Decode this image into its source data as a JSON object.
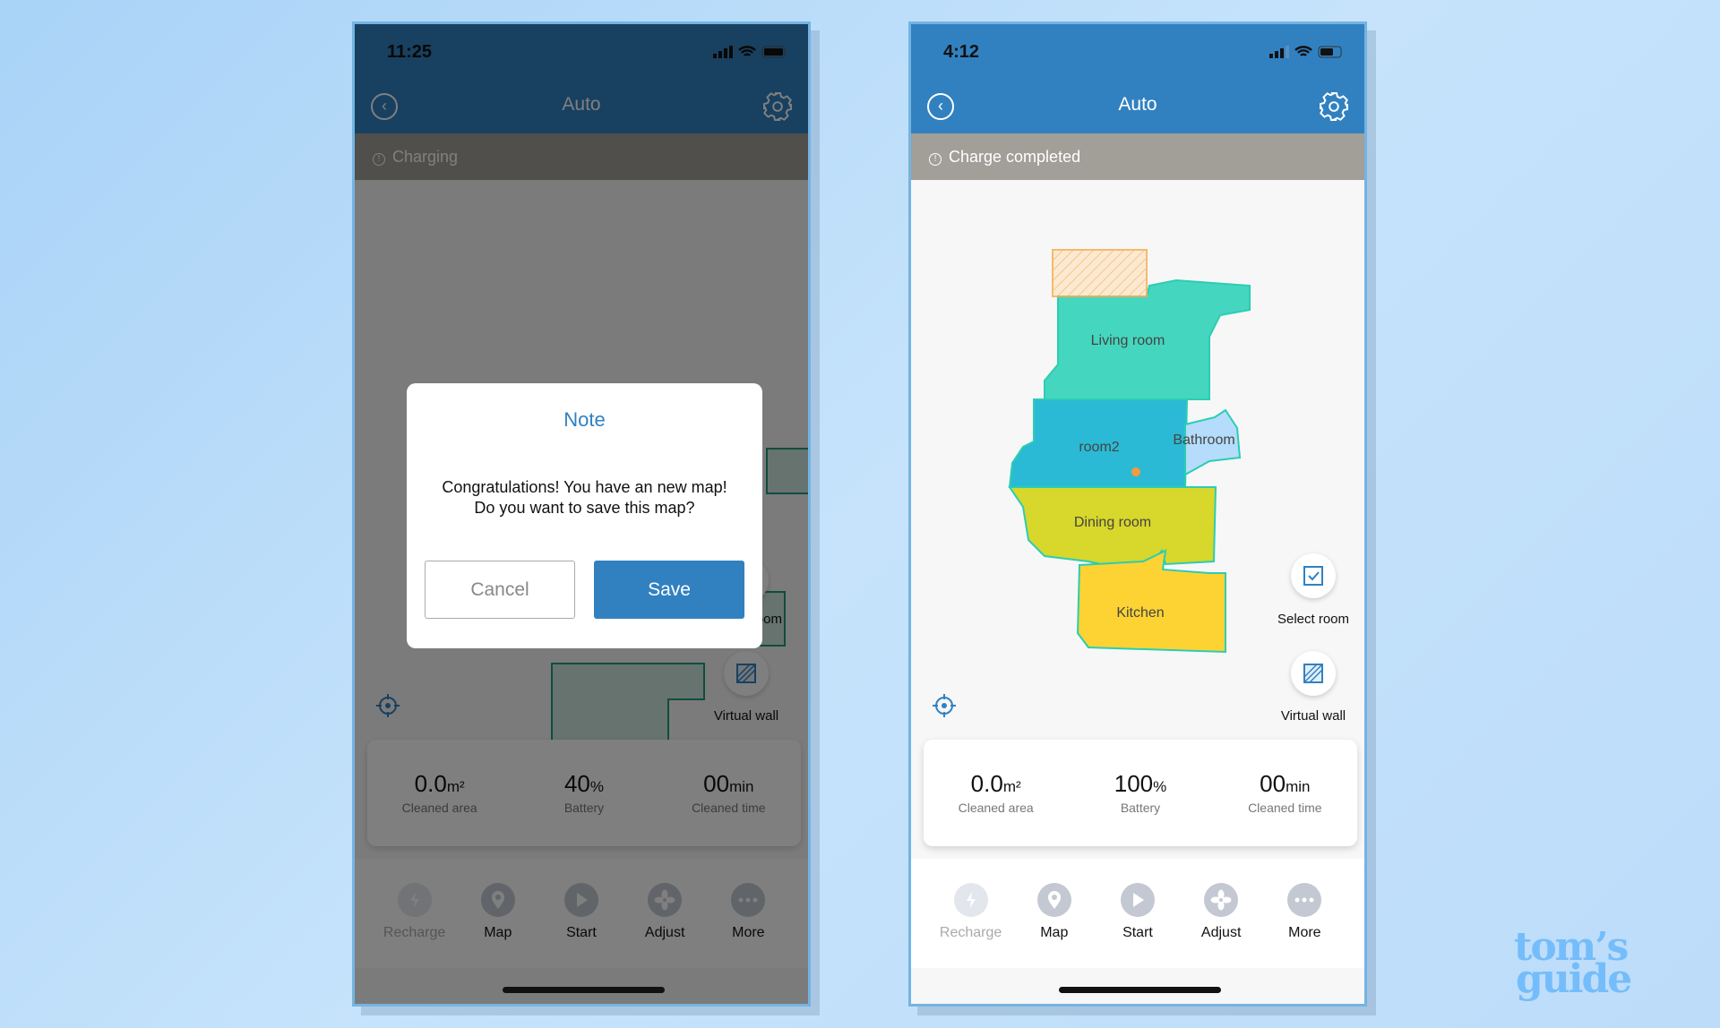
{
  "phones": [
    {
      "time": "11:25",
      "title": "Auto",
      "status": "Charging",
      "stats": [
        {
          "value": "0.0",
          "unit": "m²",
          "label": "Cleaned area"
        },
        {
          "value": "40",
          "unit": "%",
          "label": "Battery"
        },
        {
          "value": "00",
          "unit": "min",
          "label": "Cleaned time"
        }
      ],
      "select_room": "Select room",
      "virtual_wall": "Virtual wall",
      "nav": [
        "Recharge",
        "Map",
        "Start",
        "Adjust",
        "More"
      ],
      "dialog": {
        "title": "Note",
        "line1": "Congratulations! You have an new map!",
        "line2": "Do you want to save this map?",
        "cancel": "Cancel",
        "save": "Save"
      }
    },
    {
      "time": "4:12",
      "title": "Auto",
      "status": "Charge completed",
      "stats": [
        {
          "value": "0.0",
          "unit": "m²",
          "label": "Cleaned area"
        },
        {
          "value": "100",
          "unit": "%",
          "label": "Battery"
        },
        {
          "value": "00",
          "unit": "min",
          "label": "Cleaned time"
        }
      ],
      "select_room": "Select room",
      "virtual_wall": "Virtual wall",
      "nav": [
        "Recharge",
        "Map",
        "Start",
        "Adjust",
        "More"
      ],
      "rooms": {
        "living": "Living room",
        "room2": "room2",
        "bathroom": "Bathroom",
        "dining": "Dining room",
        "kitchen": "Kitchen"
      }
    }
  ],
  "colors": {
    "accent": "#3181c1",
    "living": "#45d6bf",
    "room2": "#2bbad5",
    "bathroom": "#b5dcfb",
    "dining": "#d8d72b",
    "kitchen": "#fcd333",
    "nogo": "#f5b054"
  },
  "logo": {
    "line1": "tom’s",
    "line2": "guide"
  }
}
